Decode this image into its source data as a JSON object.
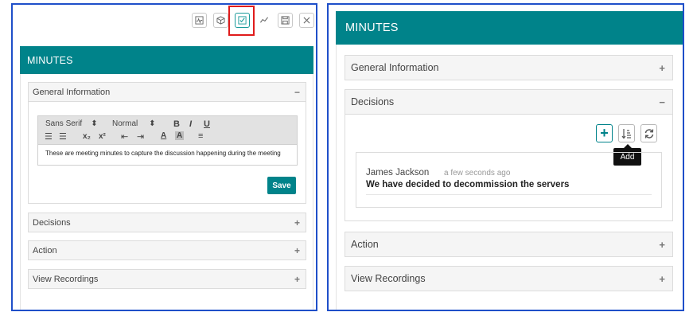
{
  "left": {
    "toolbar_icons": [
      "pulse-icon",
      "cube-icon",
      "checklist-icon",
      "trend-icon",
      "save-icon",
      "close-icon"
    ],
    "header_title": "MINUTES",
    "sections": [
      {
        "label": "General Information",
        "toggle": "−"
      },
      {
        "label": "Decisions",
        "toggle": "+"
      },
      {
        "label": "Action",
        "toggle": "+"
      },
      {
        "label": "View Recordings",
        "toggle": "+"
      }
    ],
    "editor": {
      "font": "Sans Serif",
      "size": "Normal",
      "bold": "B",
      "italic": "I",
      "underline": "U",
      "subscript": "x₂",
      "superscript": "x²",
      "font_color": "A",
      "background": "A",
      "content": "These are meeting minutes to capture the discussion happening during the meeting"
    },
    "save_label": "Save"
  },
  "right": {
    "header_title": "MINUTES",
    "sections": [
      {
        "label": "General Information",
        "toggle": "+"
      },
      {
        "label": "Decisions",
        "toggle": "−"
      },
      {
        "label": "Action",
        "toggle": "+"
      },
      {
        "label": "View Recordings",
        "toggle": "+"
      }
    ],
    "add_tooltip": "Add",
    "decision": {
      "author": "James Jackson",
      "time": "a few seconds ago",
      "text": "We have decided to decommission the servers"
    }
  },
  "colors": {
    "accent": "#00838a",
    "highlight": "#e01b1b",
    "frame": "#1f4fc9"
  }
}
